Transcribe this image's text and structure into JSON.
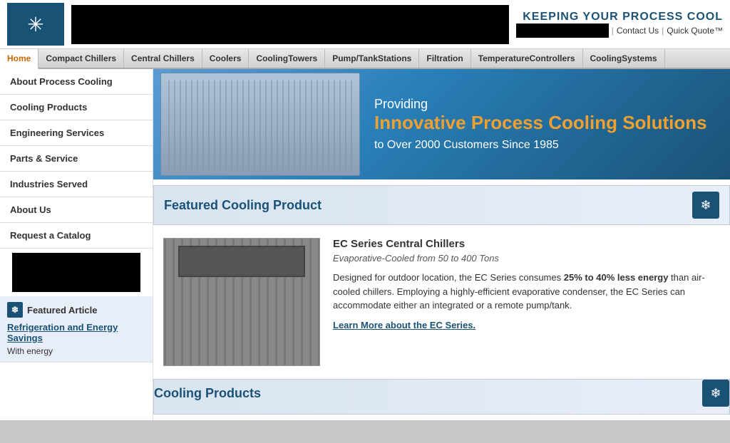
{
  "header": {
    "tagline": "KEEPING YOUR PROCESS COOL",
    "links": {
      "contact": "Contact Us",
      "quote": "Quick Quote™",
      "pipe": "|"
    }
  },
  "nav": {
    "items": [
      {
        "id": "home",
        "label": "Home",
        "active": true
      },
      {
        "id": "compact-chillers",
        "label": "Compact Chillers"
      },
      {
        "id": "central-chillers",
        "label": "Central Chillers"
      },
      {
        "id": "coolers",
        "label": "Coolers"
      },
      {
        "id": "cooling-towers",
        "label": "Cooling Towers"
      },
      {
        "id": "pump-tank-stations",
        "label": "Pump/Tank Stations"
      },
      {
        "id": "filtration",
        "label": "Filtration"
      },
      {
        "id": "temperature-controllers",
        "label": "Temperature Controllers"
      },
      {
        "id": "cooling-systems",
        "label": "Cooling Systems"
      }
    ]
  },
  "sidebar": {
    "items": [
      {
        "id": "about-process-cooling",
        "label": "About Process Cooling"
      },
      {
        "id": "cooling-products",
        "label": "Cooling Products"
      },
      {
        "id": "engineering-services",
        "label": "Engineering Services"
      },
      {
        "id": "parts-service",
        "label": "Parts & Service"
      },
      {
        "id": "industries-served",
        "label": "Industries Served"
      },
      {
        "id": "about-us",
        "label": "About Us"
      },
      {
        "id": "request-catalog",
        "label": "Request a Catalog"
      }
    ],
    "featured_article": {
      "title": "Featured Article",
      "link_text": "Refrigeration and Energy Savings",
      "body": "With energy"
    }
  },
  "banner": {
    "providing": "Providing",
    "headline": "Innovative Process Cooling Solutions",
    "sub": "to Over 2000 Customers Since 1985"
  },
  "featured_product_section": {
    "title": "Featured Cooling Product"
  },
  "product": {
    "name": "EC Series Central Chillers",
    "subtitle": "Evaporative-Cooled from 50 to 400 Tons",
    "desc_before": "Designed for outdoor location, the EC Series consumes ",
    "desc_bold": "25% to 40% less energy",
    "desc_after": " than air-cooled chillers. Employing a highly-efficient evaporative condenser, the EC Series can accommodate either an integrated or a remote pump/tank.",
    "link": "Learn More about the EC Series."
  },
  "cooling_products_section": {
    "title": "Cooling Products"
  },
  "icons": {
    "snowflake": "❄",
    "logo_snowflake": "✳"
  }
}
